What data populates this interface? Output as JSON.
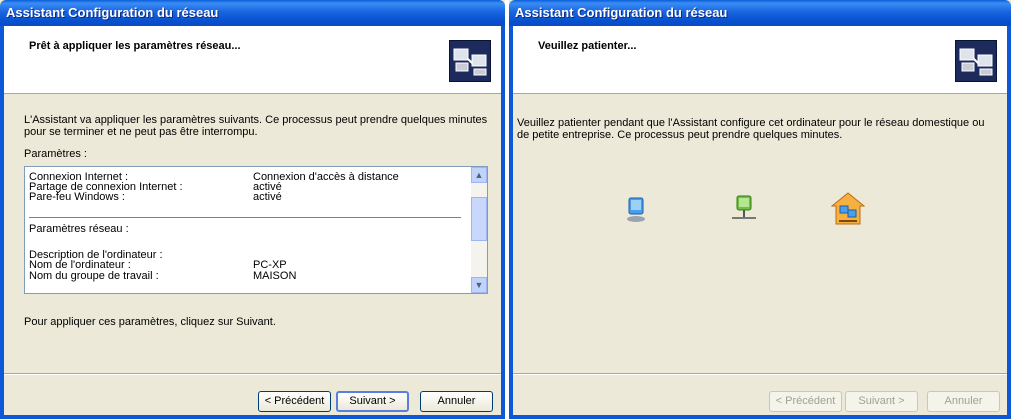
{
  "left": {
    "title": "Assistant Configuration du réseau",
    "header_title": "Prêt à appliquer les paramètres réseau...",
    "intro": "L'Assistant va appliquer les paramètres suivants. Ce processus peut prendre quelques minutes pour se terminer et ne peut pas être interrompu.",
    "params_label": "Paramètres :",
    "settings": [
      {
        "label": "Connexion Internet :",
        "value": "Connexion d'accès à distance"
      },
      {
        "label": "Partage de connexion Internet :",
        "value": "activé"
      },
      {
        "label": "Pare-feu Windows :",
        "value": "activé"
      }
    ],
    "network_label": "Paramètres réseau :",
    "computer_settings": [
      {
        "label": "Description de l'ordinateur :",
        "value": ""
      },
      {
        "label": "Nom de l'ordinateur :",
        "value": "PC-XP"
      },
      {
        "label": "Nom du groupe de travail :",
        "value": "MAISON"
      }
    ],
    "footer_text": "Pour appliquer ces paramètres, cliquez sur Suivant.",
    "buttons": {
      "back": "< Précédent",
      "next": "Suivant >",
      "cancel": "Annuler"
    }
  },
  "right": {
    "title": "Assistant Configuration du réseau",
    "header_title": "Veuillez patienter...",
    "body": "Veuillez patienter pendant que l'Assistant configure cet ordinateur pour le réseau domestique ou de petite entreprise. Ce processus peut prendre quelques minutes.",
    "icons": [
      "computer-icon",
      "network-computer-icon",
      "home-network-icon"
    ],
    "buttons": {
      "back": "< Précédent",
      "next": "Suivant >",
      "cancel": "Annuler"
    }
  }
}
